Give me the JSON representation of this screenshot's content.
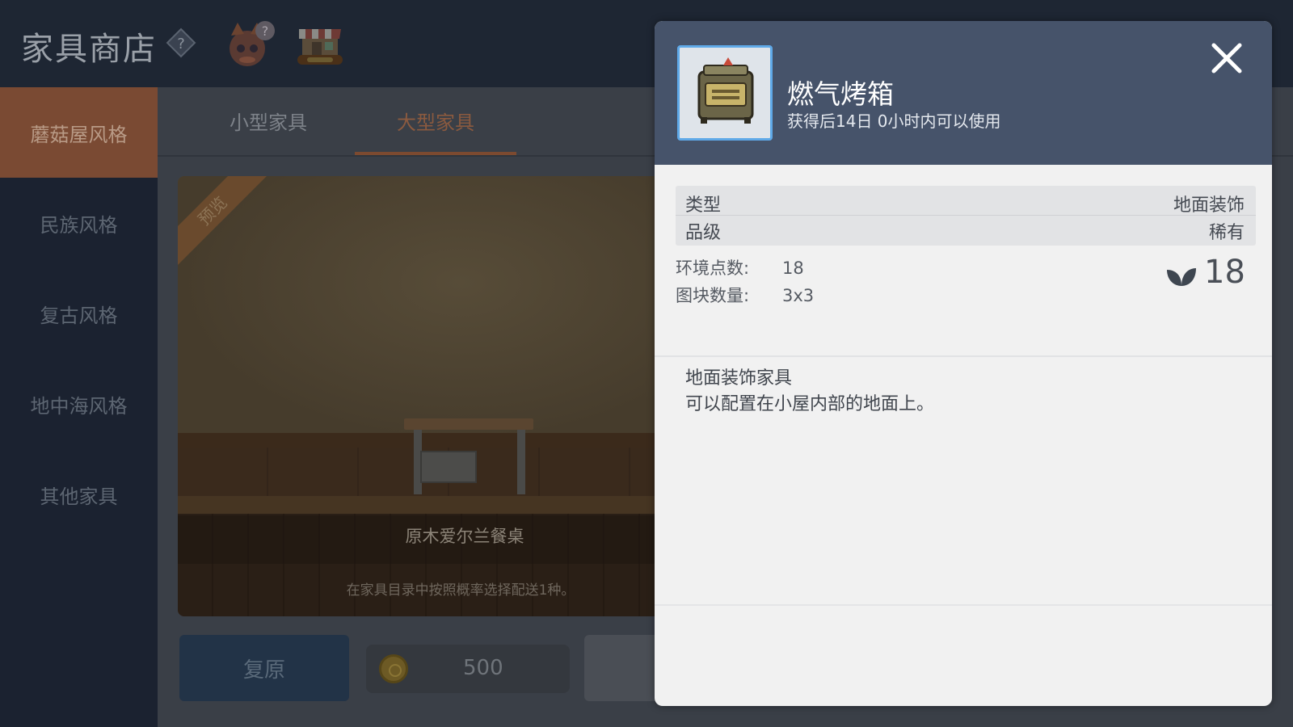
{
  "header": {
    "title": "家具商店"
  },
  "sidebar": {
    "items": [
      {
        "label": "蘑菇屋风格"
      },
      {
        "label": "民族风格"
      },
      {
        "label": "复古风格"
      },
      {
        "label": "地中海风格"
      },
      {
        "label": "其他家具"
      }
    ]
  },
  "tabs": [
    {
      "label": "小型家具"
    },
    {
      "label": "大型家具"
    }
  ],
  "preview": {
    "ribbon": "预览",
    "item_name": "原木爱尔兰餐桌",
    "note": "在家具目录中按照概率选择配送1种。"
  },
  "actions": {
    "reset_label": "复原",
    "price": "500"
  },
  "popup": {
    "title": "燃气烤箱",
    "subtitle": "获得后14日 0小时内可以使用",
    "info": [
      {
        "key": "类型",
        "value": "地面装饰"
      },
      {
        "key": "品级",
        "value": "稀有"
      }
    ],
    "stats": [
      {
        "key": "环境点数:",
        "value": "18"
      },
      {
        "key": "图块数量:",
        "value": "3x3"
      }
    ],
    "score": "18",
    "description": [
      "地面装饰家具",
      "可以配置在小屋内部的地面上。"
    ]
  },
  "colors": {
    "header_bg": "#1e2633",
    "active_sidebar": "#7a4a33",
    "popup_header": "#46536a",
    "thumb_border": "#5fa9e8"
  }
}
